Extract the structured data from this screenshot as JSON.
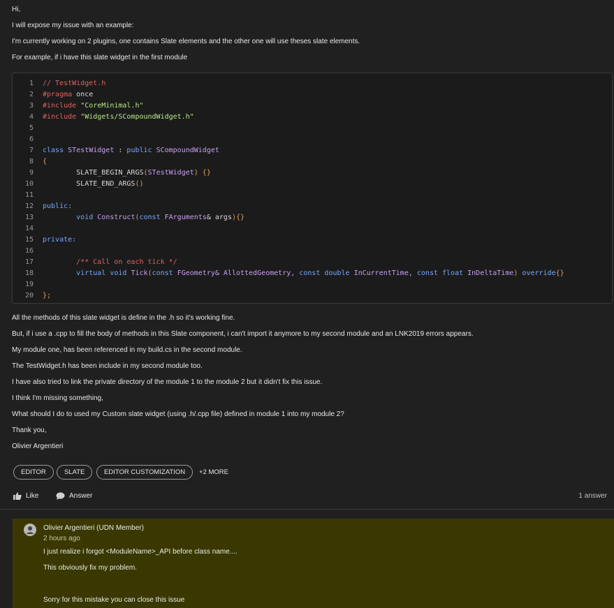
{
  "post": {
    "p1": "Hi,",
    "p2": "I will expose my issue with an example:",
    "p3": "I'm currently working on 2 plugins, one contains Slate elements and the other one will use theses slate elements.",
    "p4": "For example, if i have this slate widget in the first module",
    "p5": "All the methods of this slate widget is define in the .h so it's working fine.",
    "p6": "But, if i use a .cpp to fill the body of methods in this Slate component, i can't import it anymore to my second module and an LNK2019 errors appears.",
    "p7": "My module one, has been referenced in my build.cs in the second module.",
    "p8": "The TestWidget.h has been include in my second module too.",
    "p9": "I have also tried to link the private directory of the module 1 to the module 2 but it didn't fix this issue.",
    "p10": "I think I'm missing something,",
    "p11": "What should I do to used my Custom slate widget (using .h/.cpp file) defined in module 1 into my module 2?",
    "p12": "Thank you,",
    "p13": "Olivier Argentieri"
  },
  "code": {
    "line_numbers": [
      "1",
      "2",
      "3",
      "4",
      "5",
      "6",
      "7",
      "8",
      "9",
      "10",
      "11",
      "12",
      "13",
      "14",
      "15",
      "16",
      "17",
      "18",
      "19",
      "20"
    ],
    "l1": "// TestWidget.h",
    "l2a": "#pragma",
    "l2b": " once",
    "l3a": "#include ",
    "l3b": "\"CoreMinimal.h\"",
    "l4a": "#include ",
    "l4b": "\"Widgets/SCompoundWidget.h\"",
    "l7a": "class ",
    "l7b": "STestWidget",
    "l7c": " : ",
    "l7d": "public ",
    "l7e": "SCompoundWidget",
    "l8": "{",
    "l9a": "        SLATE_BEGIN_ARGS",
    "l9b": "(",
    "l9c": "STestWidget",
    "l9d": ") {}",
    "l10a": "        SLATE_END_ARGS",
    "l10b": "()",
    "l12": "public:",
    "l13a": "        void ",
    "l13b": "Construct",
    "l13c": "(",
    "l13d": "const ",
    "l13e": "FArguments",
    "l13f": "& ",
    "l13g": "args",
    "l13h": "){}",
    "l15": "private:",
    "l17": "        /** Call on each tick */",
    "l18a": "        virtual void ",
    "l18b": "Tick",
    "l18c": "(",
    "l18d": "const ",
    "l18e": "FGeometry",
    "l18f": "& AllottedGeometry, ",
    "l18g": "const double ",
    "l18h": "InCurrentTime, ",
    "l18i": "const float ",
    "l18j": "InDeltaTime",
    "l18k": ") ",
    "l18l": "override",
    "l18m": "{}",
    "l20": "};"
  },
  "tags": [
    "EDITOR",
    "SLATE",
    "EDITOR CUSTOMIZATION"
  ],
  "more_tags": "+2 MORE",
  "actions": {
    "like": "Like",
    "answer": "Answer",
    "answer_count": "1 answer"
  },
  "reply": {
    "author": "Olivier Argentieri (UDN Member)",
    "time": "2 hours ago",
    "line1": "I just realize i forgot <ModuleName>_API before class name....",
    "line2": "This obviously fix my problem.",
    "line3": "Sorry for this mistake you can close this issue"
  }
}
